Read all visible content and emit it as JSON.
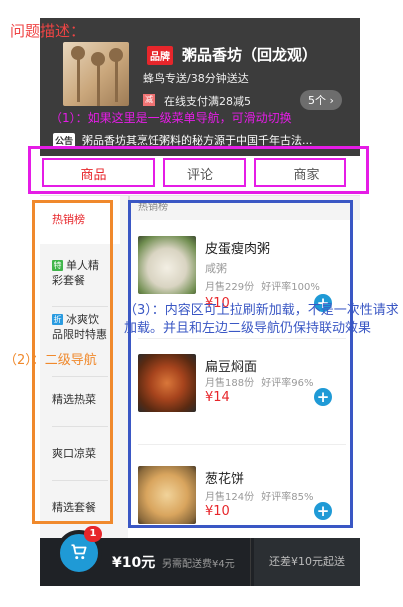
{
  "question_title": "问题描述：",
  "store": {
    "brand_badge": "品牌",
    "name": "粥品香坊（回龙观）",
    "delivery_info": "蜂鸟专送/38分钟送达",
    "promo_tag": "减",
    "promo_text": "在线支付满28减5",
    "promo_count": "5个 ›",
    "notice_tag": "公告",
    "notice_text": "粥品香坊其烹饪粥料的秘方源于中国千年古法..."
  },
  "tabs": [
    {
      "label": "商品"
    },
    {
      "label": "评论"
    },
    {
      "label": "商家"
    }
  ],
  "sidebar": {
    "items": [
      {
        "label": "热销榜"
      },
      {
        "icon": "特",
        "label": "单人精彩套餐"
      },
      {
        "icon": "折",
        "label": "冰爽饮品限时特惠"
      },
      {
        "label": "精选热菜"
      },
      {
        "label": "爽口凉菜"
      },
      {
        "label": "精选套餐"
      }
    ]
  },
  "section_title": "热销榜",
  "foods": [
    {
      "name": "皮蛋瘦肉粥",
      "desc": "咸粥",
      "stats": "月售229份 好评率100%",
      "price": "¥10"
    },
    {
      "name": "扁豆焖面",
      "desc": "",
      "stats": "月售188份 好评率96%",
      "price": "¥14"
    },
    {
      "name": "葱花饼",
      "desc": "",
      "stats": "月售124份 好评率85%",
      "price": "¥10"
    }
  ],
  "cart": {
    "count": "1",
    "total": "¥10元",
    "delivery_fee": "另需配送费¥4元",
    "minimum": "还差¥10元起送"
  },
  "annotations": {
    "note1": "（1）：如果这里是一级菜单导航，可滑动切换",
    "note2": "（2）：二级导航",
    "note3": "（3）：内容区可上拉刷新加载，不是一次性请求加载。并且和左边二级导航仍保持联动效果"
  },
  "colors": {
    "accent_red": "#e7262b",
    "accent_blue": "#1f9ad6",
    "annotation_magenta": "#e51ce6",
    "annotation_orange": "#f0892c",
    "annotation_blue": "#3a57c4"
  }
}
